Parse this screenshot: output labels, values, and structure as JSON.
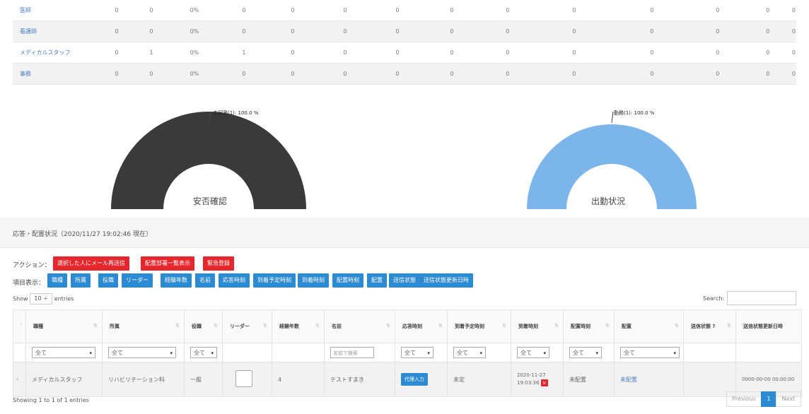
{
  "summary_table": {
    "rows": [
      {
        "name": "医師",
        "cells": [
          "0",
          "0",
          "0%",
          "0",
          "0",
          "0",
          "0",
          "0",
          "0",
          "0",
          "0",
          "0",
          "0",
          "0"
        ]
      },
      {
        "name": "看護師",
        "cells": [
          "0",
          "0",
          "0%",
          "0",
          "0",
          "0",
          "0",
          "0",
          "0",
          "0",
          "0",
          "0",
          "0",
          "0"
        ]
      },
      {
        "name": "メディカルスタッフ",
        "cells": [
          "0",
          "1",
          "0%",
          "1",
          "0",
          "0",
          "0",
          "0",
          "0",
          "0",
          "0",
          "0",
          "0",
          "0"
        ]
      },
      {
        "name": "事務",
        "cells": [
          "0",
          "0",
          "0%",
          "0",
          "0",
          "0",
          "0",
          "0",
          "0",
          "0",
          "0",
          "0",
          "0",
          "0"
        ]
      }
    ]
  },
  "chart_data": [
    {
      "type": "pie",
      "title": "安否確認",
      "categories": [
        "未回答(1)"
      ],
      "values": [
        100.0
      ],
      "annotation": "未回答(1): 100.0 %",
      "colors": [
        "#3a3a3c"
      ]
    },
    {
      "type": "pie",
      "title": "出勤状況",
      "categories": [
        "勤務(1)"
      ],
      "values": [
        100.0
      ],
      "annotation": "勤務(1): 100.0 %",
      "colors": [
        "#7cb5ec"
      ]
    }
  ],
  "panel": {
    "header": "応答・配置状況（2020/11/27 19:02:46 現在）",
    "action_label": "アクション：",
    "actions": [
      "選択した人にメール再送信",
      "配置部署一覧表示",
      "緊急登録"
    ],
    "columns_label": "項目表示：",
    "column_toggles": [
      "職種",
      "所属",
      "役職",
      "リーダー",
      "経験年数",
      "名前",
      "応答時刻",
      "到着予定時刻",
      "到着時刻",
      "配置時刻",
      "配置",
      "送信状態",
      "送信状態更新日時"
    ],
    "show": {
      "prefix": "Show",
      "value": "10",
      "suffix": "entries"
    },
    "search_label": "Search:",
    "table": {
      "headers": [
        "職種",
        "所属",
        "役職",
        "リーダー",
        "経験年数",
        "名前",
        "応答時刻",
        "到着予定時刻",
        "到着時刻",
        "配置時刻",
        "配置",
        "送信状態 ?",
        "送信状態更新日時"
      ],
      "filters": {
        "all": "全て",
        "name_placeholder": "名前で検索"
      },
      "row": {
        "job": "メディカルスタッフ",
        "dept": "リハビリテーション科",
        "position": "一般",
        "experience": "4",
        "name": "テストすまき",
        "response": "代理入力",
        "eta": "未定",
        "arrival_date": "2020-11-27",
        "arrival_time": "19:03:36",
        "placement_time": "未配置",
        "placement": "未配置",
        "sent_updated": "0000-00-00 00:00:00"
      }
    },
    "footer": "Showing 1 to 1 of 1 entries",
    "pager": {
      "prev": "Previous",
      "page": "1",
      "next": "Next"
    }
  },
  "colors": {
    "red": "#e6262d",
    "blue": "#2b8ad1",
    "gauge_dark": "#3a3a3c",
    "gauge_light": "#7cb5ec"
  }
}
